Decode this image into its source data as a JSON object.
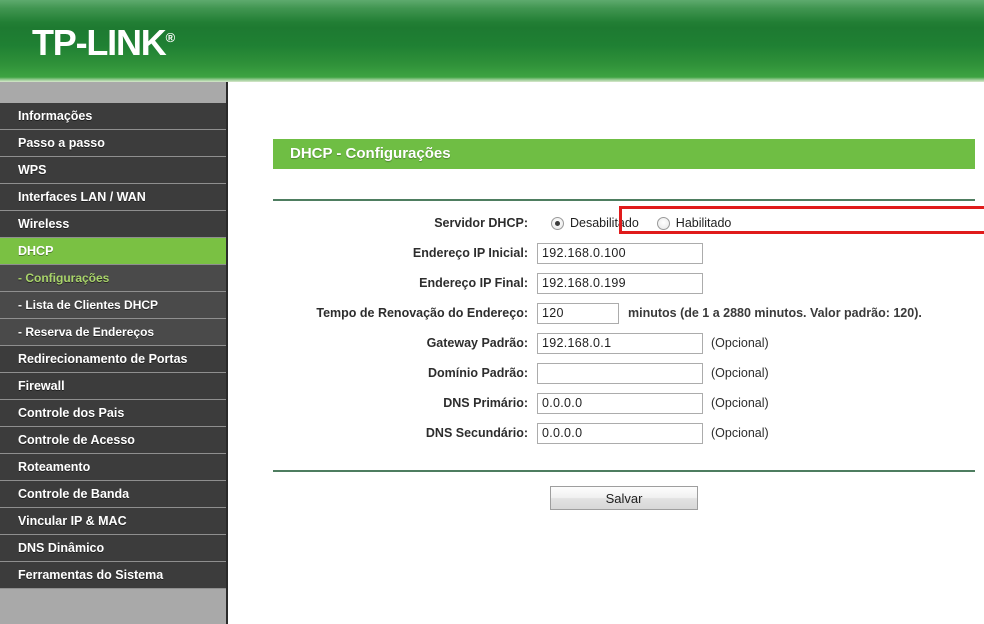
{
  "brand": {
    "name": "TP-LINK",
    "registered_mark": "®"
  },
  "sidebar": {
    "items": [
      {
        "label": "Informações",
        "state": "normal"
      },
      {
        "label": "Passo a passo",
        "state": "normal"
      },
      {
        "label": "WPS",
        "state": "normal"
      },
      {
        "label": "Interfaces LAN / WAN",
        "state": "normal"
      },
      {
        "label": "Wireless",
        "state": "normal"
      },
      {
        "label": "DHCP",
        "state": "active"
      },
      {
        "label": "- Configurações",
        "state": "sub-active"
      },
      {
        "label": "- Lista de Clientes DHCP",
        "state": "sub"
      },
      {
        "label": "- Reserva de Endereços",
        "state": "sub"
      },
      {
        "label": "Redirecionamento de Portas",
        "state": "normal"
      },
      {
        "label": "Firewall",
        "state": "normal"
      },
      {
        "label": "Controle dos Pais",
        "state": "normal"
      },
      {
        "label": "Controle de Acesso",
        "state": "normal"
      },
      {
        "label": "Roteamento",
        "state": "normal"
      },
      {
        "label": "Controle de Banda",
        "state": "normal"
      },
      {
        "label": "Vincular IP & MAC",
        "state": "normal"
      },
      {
        "label": "DNS Dinâmico",
        "state": "normal"
      },
      {
        "label": "Ferramentas do Sistema",
        "state": "normal"
      }
    ]
  },
  "main": {
    "title": "DHCP - Configurações",
    "server": {
      "label": "Servidor DHCP:",
      "options": [
        {
          "label": "Desabilitado",
          "selected": true
        },
        {
          "label": "Habilitado",
          "selected": false
        }
      ]
    },
    "fields": {
      "ip_start": {
        "label": "Endereço IP Inicial:",
        "value": "192.168.0.100"
      },
      "ip_end": {
        "label": "Endereço IP Final:",
        "value": "192.168.0.199"
      },
      "lease_time": {
        "label": "Tempo de Renovação do Endereço:",
        "value": "120",
        "hint": "minutos (de 1 a 2880 minutos. Valor padrão: 120)."
      },
      "gateway": {
        "label": "Gateway Padrão:",
        "value": "192.168.0.1",
        "optional": "(Opcional)"
      },
      "domain": {
        "label": "Domínio Padrão:",
        "value": "",
        "optional": "(Opcional)"
      },
      "dns_primary": {
        "label": "DNS Primário:",
        "value": "0.0.0.0",
        "optional": "(Opcional)"
      },
      "dns_secondary": {
        "label": "DNS Secundário:",
        "value": "0.0.0.0",
        "optional": "(Opcional)"
      }
    },
    "save_label": "Salvar"
  },
  "colors": {
    "brand_green": "#1e7a31",
    "accent_green": "#7ac143",
    "title_green": "#6fbe44",
    "highlight_red": "#e01b1b",
    "sidebar_dark": "#3c3c3c"
  }
}
